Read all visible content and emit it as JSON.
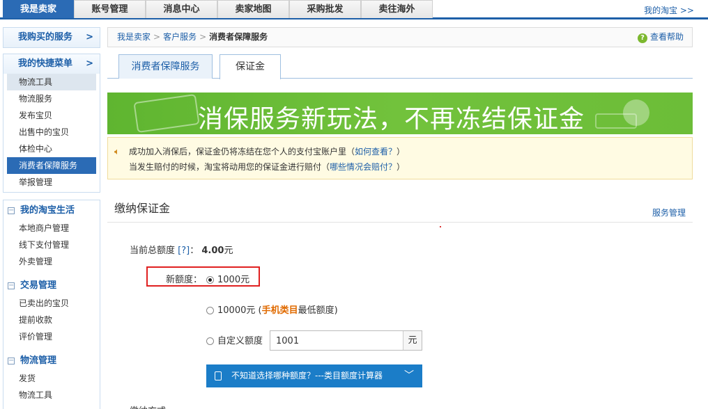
{
  "topnav": {
    "tabs": [
      "我是卖家",
      "账号管理",
      "消息中心",
      "卖家地图",
      "采购批发",
      "卖往海外"
    ],
    "right_link": "我的淘宝 >>"
  },
  "sidebar": {
    "bought_services": {
      "label": "我购买的服务",
      "arrow": ">"
    },
    "quick_menu": {
      "label": "我的快捷菜单",
      "arrow": ">",
      "items": [
        "物流工具",
        "物流服务",
        "发布宝贝",
        "出售中的宝贝",
        "体检中心",
        "消费者保障服务",
        "举报管理"
      ]
    },
    "sections": [
      {
        "label": "我的淘宝生活",
        "items": [
          "本地商户管理",
          "线下支付管理",
          "外卖管理"
        ]
      },
      {
        "label": "交易管理",
        "items": [
          "已卖出的宝贝",
          "提前收款",
          "评价管理"
        ]
      },
      {
        "label": "物流管理",
        "items": [
          "发货",
          "物流工具"
        ]
      }
    ]
  },
  "breadcrumb": {
    "items": [
      "我是卖家",
      "客户服务"
    ],
    "separator": ">",
    "current": "消费者保障服务",
    "help": "查看帮助"
  },
  "tabs": [
    "消费者保障服务",
    "保证金"
  ],
  "banner": {
    "text": "消保服务新玩法，不再冻结保证金"
  },
  "notice": {
    "line1": "成功加入消保后，保证金仍将冻结在您个人的支付宝账户里（",
    "line1_link": "如何查看？",
    "line1_end": "）",
    "line2": "当发生赔付的时候，淘宝将动用您的保证金进行赔付（",
    "line2_link": "哪些情况会赔付？",
    "line2_end": "）"
  },
  "section": {
    "title": "缴纳保证金",
    "manage_link": "服务管理"
  },
  "form": {
    "total_label": "当前总额度",
    "total_help": "[?]",
    "total_colon": "：",
    "total_value": "4.00",
    "total_unit": "元",
    "new_label": "新额度：",
    "option1": "1000元",
    "option2_prefix": "10000元 (",
    "option2_em": "手机类目",
    "option2_suffix": "最低额度)",
    "option3": "自定义额度",
    "custom_value": "1001",
    "custom_unit": "元",
    "calc_text": "不知道选择哪种额度？---类目额度计算器",
    "cut_text": "缴纳方式"
  },
  "colors": {
    "accent": "#2b6bb5",
    "calc_bg": "#1b7dc8",
    "banner_green": "#6cbd38",
    "highlight_red": "#e02020",
    "emphasis_orange": "#e06a00"
  }
}
